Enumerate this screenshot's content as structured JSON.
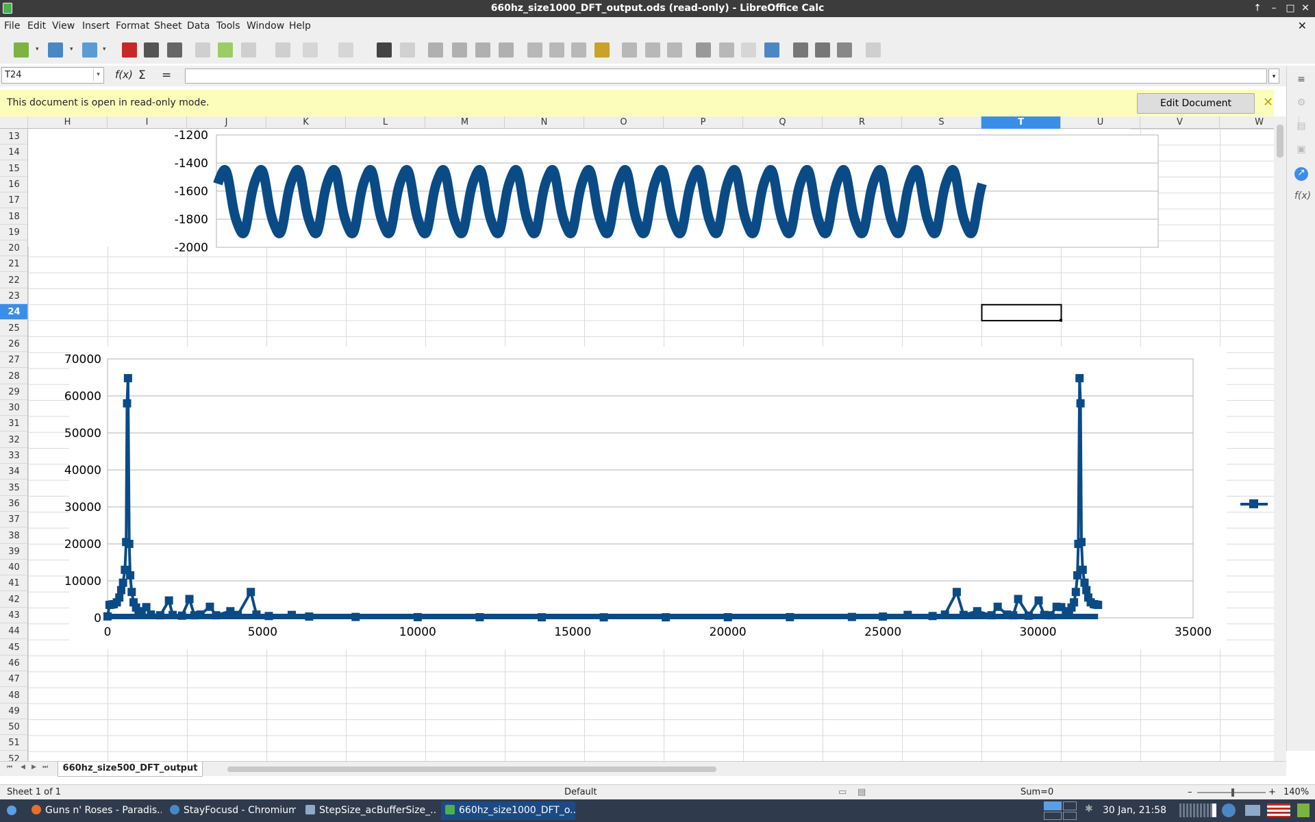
{
  "window": {
    "title": "660hz_size1000_DFT_output.ods (read-only) - LibreOffice Calc"
  },
  "menu": [
    "File",
    "Edit",
    "View",
    "Insert",
    "Format",
    "Sheet",
    "Data",
    "Tools",
    "Window",
    "Help"
  ],
  "formula_bar": {
    "cell_ref": "T24",
    "formula": ""
  },
  "infobar": {
    "message": "This document is open in read-only mode.",
    "edit_button": "Edit Document"
  },
  "columns": [
    "H",
    "I",
    "J",
    "K",
    "L",
    "M",
    "N",
    "O",
    "P",
    "Q",
    "R",
    "S",
    "T",
    "U",
    "V",
    "W"
  ],
  "selected_column": "T",
  "rows": [
    13,
    14,
    15,
    16,
    17,
    18,
    19,
    20,
    21,
    22,
    23,
    24,
    25,
    26,
    27,
    28,
    29,
    30,
    31,
    32,
    33,
    34,
    35,
    36,
    37,
    38,
    39,
    40,
    41,
    42,
    43,
    44,
    45,
    46,
    47,
    48,
    49,
    50,
    51,
    52
  ],
  "selected_row": 24,
  "sheet_tab": "660hz_size500_DFT_output",
  "status": {
    "sheet": "Sheet 1 of 1",
    "style": "Default",
    "sum": "Sum=0",
    "zoom": "140%"
  },
  "taskbar": {
    "tasks": [
      "Guns n' Roses - Paradis...",
      "StayFocusd - Chromium",
      "StepSize_acBufferSize_...",
      "660hz_size1000_DFT_o..."
    ],
    "clock": "30 Jan, 21:58"
  },
  "colors": {
    "series": "#0a4b86",
    "selection": "#3b8ee8",
    "infobar": "#fdfdbb"
  },
  "chart_data": [
    {
      "type": "line",
      "y_ticks": [
        "-1200",
        "-1400",
        "-1600",
        "-1800",
        "-2000"
      ],
      "ylim": [
        -2000,
        -1200
      ],
      "cycles": 21,
      "y_high": -1450,
      "y_low": -1900,
      "grid": true
    },
    {
      "type": "line",
      "x_ticks": [
        "0",
        "5000",
        "10000",
        "15000",
        "20000",
        "25000",
        "30000",
        "35000"
      ],
      "y_ticks": [
        "70000",
        "60000",
        "50000",
        "40000",
        "30000",
        "20000",
        "10000",
        "0"
      ],
      "xlim": [
        0,
        35000
      ],
      "ylim": [
        0,
        70000
      ],
      "grid": true,
      "legend": "right",
      "points": [
        [
          0,
          400
        ],
        [
          64,
          3500
        ],
        [
          130,
          3600
        ],
        [
          200,
          3700
        ],
        [
          300,
          4200
        ],
        [
          380,
          5500
        ],
        [
          440,
          7500
        ],
        [
          500,
          9500
        ],
        [
          560,
          13000
        ],
        [
          600,
          20500
        ],
        [
          630,
          58000
        ],
        [
          660,
          64800
        ],
        [
          700,
          20000
        ],
        [
          730,
          11500
        ],
        [
          780,
          7000
        ],
        [
          840,
          4200
        ],
        [
          920,
          2800
        ],
        [
          1000,
          1800
        ],
        [
          1100,
          1200
        ],
        [
          1250,
          2900
        ],
        [
          1400,
          900
        ],
        [
          1700,
          700
        ],
        [
          1980,
          4700
        ],
        [
          2100,
          800
        ],
        [
          2400,
          600
        ],
        [
          2640,
          5100
        ],
        [
          2800,
          700
        ],
        [
          3000,
          900
        ],
        [
          3300,
          3000
        ],
        [
          3500,
          700
        ],
        [
          3960,
          1800
        ],
        [
          4200,
          800
        ],
        [
          4620,
          7000
        ],
        [
          4800,
          900
        ],
        [
          5200,
          500
        ],
        [
          5940,
          800
        ],
        [
          6500,
          350
        ],
        [
          8000,
          250
        ],
        [
          10000,
          200
        ],
        [
          12000,
          180
        ],
        [
          14000,
          160
        ],
        [
          16000,
          150
        ],
        [
          18000,
          160
        ],
        [
          20000,
          180
        ],
        [
          22000,
          200
        ],
        [
          24000,
          250
        ],
        [
          25000,
          350
        ],
        [
          25800,
          800
        ],
        [
          26600,
          500
        ],
        [
          27000,
          900
        ],
        [
          27380,
          7000
        ],
        [
          27600,
          800
        ],
        [
          28040,
          1800
        ],
        [
          28500,
          700
        ],
        [
          28700,
          3000
        ],
        [
          29000,
          900
        ],
        [
          29200,
          700
        ],
        [
          29360,
          5100
        ],
        [
          29700,
          600
        ],
        [
          30020,
          4700
        ],
        [
          30200,
          800
        ],
        [
          30400,
          700
        ],
        [
          30600,
          3000
        ],
        [
          30750,
          2900
        ],
        [
          30900,
          1200
        ],
        [
          31000,
          1800
        ],
        [
          31080,
          2800
        ],
        [
          31160,
          4200
        ],
        [
          31220,
          7000
        ],
        [
          31270,
          11500
        ],
        [
          31300,
          20000
        ],
        [
          31340,
          64800
        ],
        [
          31370,
          58000
        ],
        [
          31400,
          20500
        ],
        [
          31440,
          13000
        ],
        [
          31500,
          9500
        ],
        [
          31560,
          7500
        ],
        [
          31620,
          5500
        ],
        [
          31700,
          4200
        ],
        [
          31800,
          3700
        ],
        [
          31870,
          3600
        ],
        [
          31936,
          3500
        ]
      ]
    }
  ]
}
